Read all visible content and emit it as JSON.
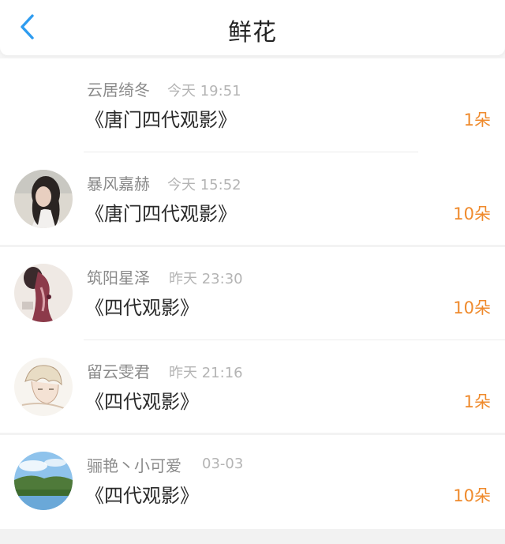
{
  "header": {
    "title": "鲜花",
    "back_icon": "chevron-left-icon",
    "accent_color": "#2e9cf0"
  },
  "flowers": [
    {
      "user": "云居绮冬",
      "time": "今天 19:51",
      "work": "《唐门四代观影》",
      "count": "1朵",
      "avatar": "none"
    },
    {
      "user": "暴风嘉赫",
      "time": "今天 15:52",
      "work": "《唐门四代观影》",
      "count": "10朵",
      "avatar": "photo-girl"
    },
    {
      "user": "筑阳星泽",
      "time": "昨天 23:30",
      "work": "《四代观影》",
      "count": "10朵",
      "avatar": "photo-figure"
    },
    {
      "user": "留云雯君",
      "time": "昨天 21:16",
      "work": "《四代观影》",
      "count": "1朵",
      "avatar": "anime-sketch"
    },
    {
      "user": "骊艳丶小可爱",
      "time": "03-03",
      "work": "《四代观影》",
      "count": "10朵",
      "avatar": "landscape"
    }
  ],
  "count_color": "#ef8a2c"
}
